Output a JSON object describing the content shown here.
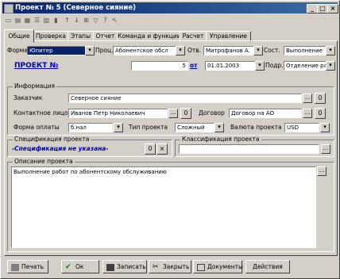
{
  "window": {
    "title": "Проект №      5 (Северное сияние)",
    "minimize": "_",
    "maximize": "□",
    "close": "×"
  },
  "tabs": [
    {
      "label": "Общие"
    },
    {
      "label": "Проверка"
    },
    {
      "label": "Этапы"
    },
    {
      "label": "Отчет"
    },
    {
      "label": "Команда и функции"
    },
    {
      "label": "Расчет"
    },
    {
      "label": "Управление"
    }
  ],
  "top": {
    "forma_label": "Форма",
    "forma_value": "Юпитер",
    "proc_label": "Проц.",
    "proc_value": "Абонентское обсл",
    "otv_label": "Отв.",
    "otv_value": "Митрофанов А.",
    "sost_label": "Сост.",
    "sost_value": "Выполнение",
    "project_link": "ПРОЕКТ №",
    "project_number": "5",
    "ot_link": "от",
    "project_date": "01.01.2003",
    "podr_label": "Подр.",
    "podr_value": "Отделение ра"
  },
  "info": {
    "group_title": "Информация",
    "zakazchik_label": "Заказчик",
    "zakazchik_value": "Северное сияние",
    "kontakt_label": "Контактное лицо",
    "kontakt_value": "Иванов Петр Николаевич",
    "dogovor_label": "Договор",
    "dogovor_value": "Договор на АО",
    "forma_oplaty_label": "Форма оплаты",
    "forma_oplaty_value": "б.нал",
    "tip_label": "Тип проекта",
    "tip_value": "Сложный",
    "valuta_label": "Валюта проекта",
    "valuta_value": "USD",
    "o_button": "0"
  },
  "spec": {
    "group_title": "Спецификация проекта",
    "value": "-Спецификация не указана-",
    "count": "0",
    "clear": "×"
  },
  "classif": {
    "group_title": "Классификация проекта",
    "value": ""
  },
  "description": {
    "group_title": "Описание проекта",
    "text": "Выполнение работ по абонентскому обслуживанию"
  },
  "buttons": [
    {
      "label": "Печать"
    },
    {
      "label": "Ок"
    },
    {
      "label": "Записать"
    },
    {
      "label": "Закрыть"
    },
    {
      "label": "Документы"
    },
    {
      "label": "Действия"
    }
  ]
}
